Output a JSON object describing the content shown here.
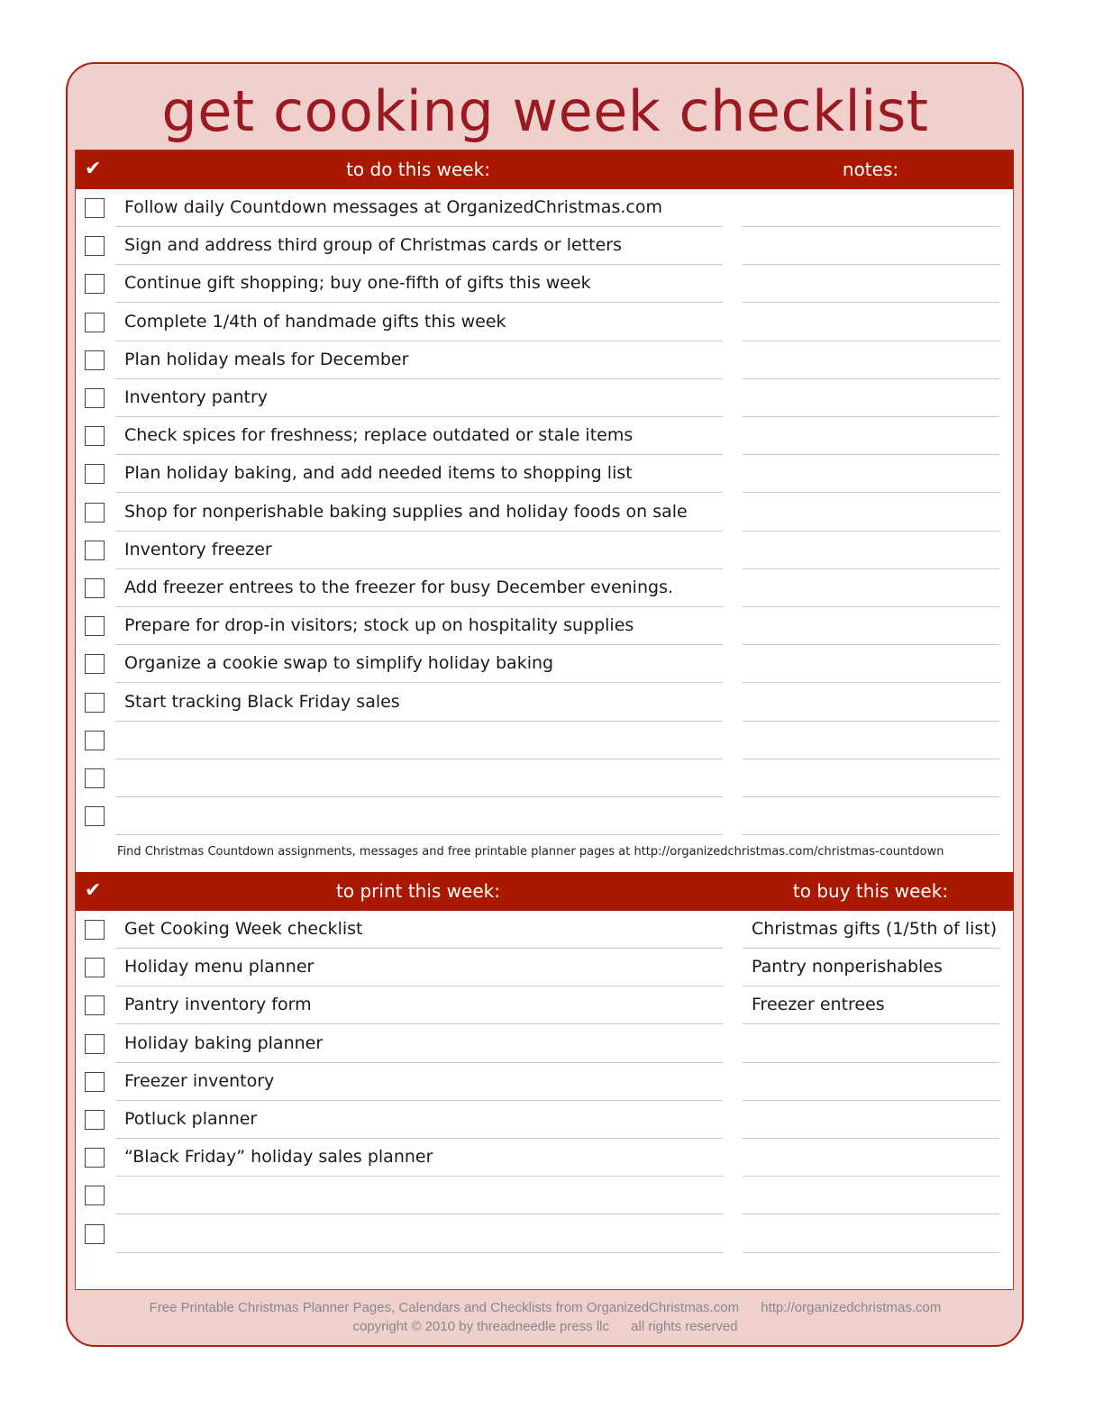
{
  "title": "get cooking week checklist",
  "todo_section": {
    "check_icon": "✔",
    "header_main": "to do this week:",
    "header_side": "notes:",
    "items": [
      "Follow daily Countdown messages at OrganizedChristmas.com",
      "Sign and address third group of Christmas cards or letters",
      "Continue gift shopping; buy one-fifth of gifts this week",
      "Complete 1/4th of handmade gifts this week",
      "Plan holiday meals for December",
      "Inventory pantry",
      "Check spices for freshness; replace outdated or stale items",
      "Plan holiday baking, and add needed items to shopping list",
      "Shop for nonperishable baking supplies and holiday foods on sale",
      "Inventory freezer",
      "Add freezer entrees to the freezer for busy December evenings.",
      "Prepare for drop-in visitors; stock up on hospitality supplies",
      "Organize a cookie swap to simplify holiday baking",
      "Start tracking Black Friday sales",
      "",
      "",
      ""
    ],
    "footnote": "Find Christmas Countdown assignments, messages and free printable planner pages at http://organizedchristmas.com/christmas-countdown"
  },
  "print_section": {
    "check_icon": "✔",
    "header_main": "to print this week:",
    "header_side": "to buy this week:",
    "items": [
      "Get Cooking Week checklist",
      "Holiday menu planner",
      "Pantry inventory form",
      "Holiday baking planner",
      "Freezer inventory",
      "Potluck planner",
      "“Black Friday” holiday sales planner",
      "",
      ""
    ],
    "buy_items": [
      "Christmas gifts (1/5th of list)",
      "Pantry nonperishables",
      "Freezer entrees",
      "",
      "",
      "",
      "",
      "",
      ""
    ]
  },
  "footer": {
    "line1_left": "Free Printable Christmas Planner Pages, Calendars and Checklists from OrganizedChristmas.com",
    "line1_right": "http://organizedchristmas.com",
    "line2_left": "copyright © 2010 by threadneedle press llc",
    "line2_right": "all rights reserved"
  },
  "colors": {
    "accent": "#ab1800",
    "title": "#9b1a22",
    "frame_bg": "#f0d0cd"
  }
}
